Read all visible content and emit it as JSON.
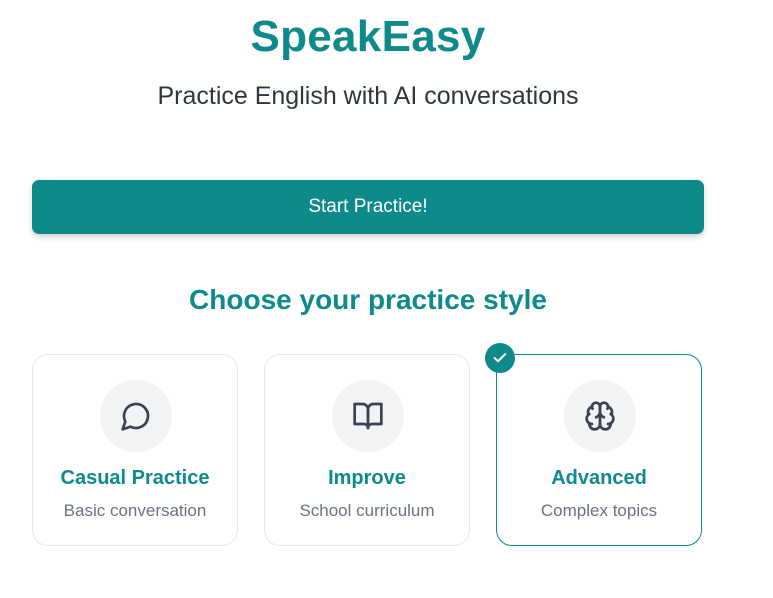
{
  "header": {
    "title": "SpeakEasy",
    "subtitle": "Practice English with AI conversations"
  },
  "start_button": {
    "label": "Start Practice!"
  },
  "practice": {
    "heading": "Choose your practice style",
    "options": [
      {
        "icon": "message-circle-icon",
        "title": "Casual Practice",
        "description": "Basic conversation",
        "selected": false
      },
      {
        "icon": "book-open-icon",
        "title": "Improve",
        "description": "School curriculum",
        "selected": false
      },
      {
        "icon": "brain-icon",
        "title": "Advanced",
        "description": "Complex topics",
        "selected": true
      }
    ]
  },
  "colors": {
    "accent": "#0e8a8a",
    "text": "#2f3640",
    "muted": "#6b7280",
    "icon_bg": "#f1f3f5",
    "border": "#e5e7eb"
  }
}
